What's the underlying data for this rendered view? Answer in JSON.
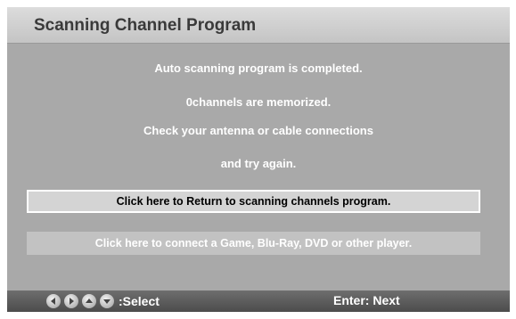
{
  "header": {
    "title": "Scanning Channel Program"
  },
  "messages": [
    "Auto scanning program is completed.",
    "0channels are memorized.",
    "Check your antenna or cable connections",
    "and try again."
  ],
  "buttons": {
    "return_label": "Click here to Return to scanning channels program.",
    "connect_label": "Click here to connect a Game, Blu-Ray, DVD or other player."
  },
  "footer": {
    "arrow_icons": [
      "left-arrow-icon",
      "right-arrow-icon",
      "up-arrow-icon",
      "down-arrow-icon"
    ],
    "select_label": ":Select",
    "enter_label": "Enter: Next"
  },
  "colors": {
    "panel": "#a9a9a9",
    "title_bar": "#d0d0d0",
    "selected_button": "#d4d4d4",
    "footer": "#5a5a5a"
  }
}
